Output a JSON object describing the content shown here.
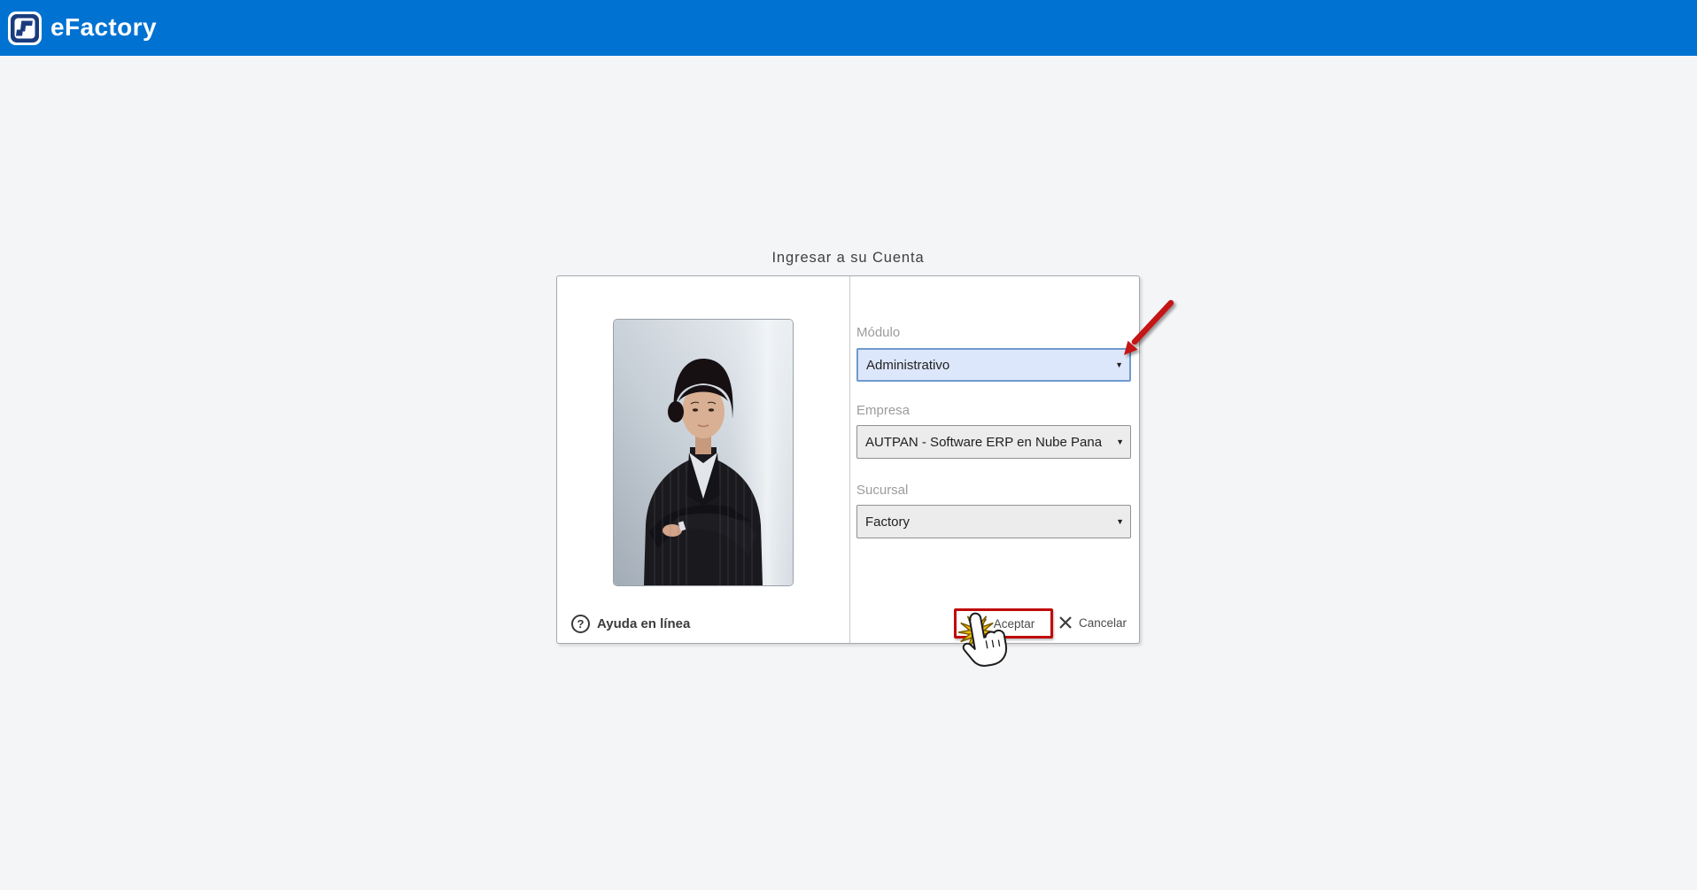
{
  "header": {
    "app_name": "eFactory"
  },
  "page": {
    "title": "Ingresar a su Cuenta"
  },
  "form": {
    "modulo_label": "Módulo",
    "modulo_value": "Administrativo",
    "empresa_label": "Empresa",
    "empresa_value": "AUTPAN - Software ERP en Nube Pana",
    "sucursal_label": "Sucursal",
    "sucursal_value": "Factory",
    "accept_label": "Aceptar",
    "cancel_label": "Cancelar",
    "help_label": "Ayuda en línea"
  },
  "icons": {
    "question_glyph": "?",
    "dropdown_glyph": "▼"
  },
  "colors": {
    "header_blue": "#0072d2",
    "page_background": "#f4f5f7",
    "focused_select_bg": "#dde7fb",
    "focused_select_border": "#6f9ad0",
    "select_bg": "#ececec",
    "select_border": "#919191",
    "annotation_red": "#c00a0a",
    "starburst_yellow": "#f5bd0c"
  }
}
